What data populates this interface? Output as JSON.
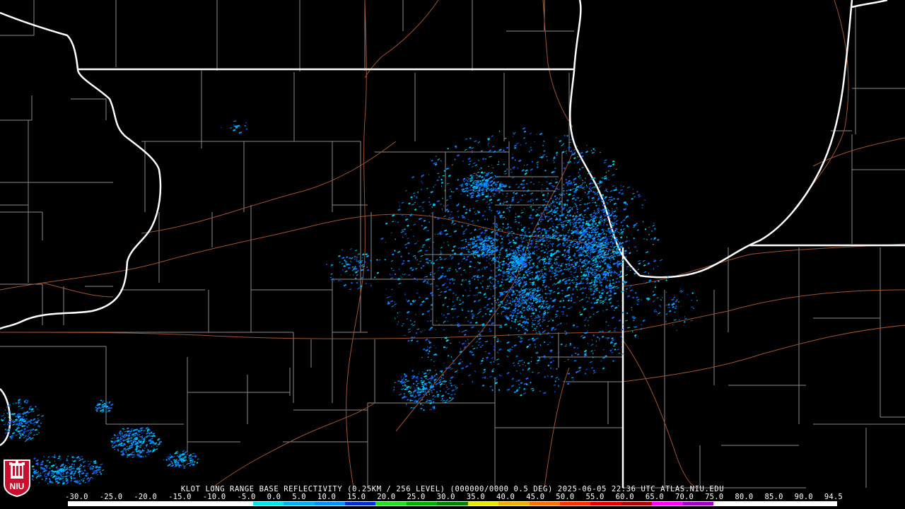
{
  "caption": "KLOT LONG RANGE BASE REFLECTIVITY (0.25KM / 256 LEVEL) (000000/0000 0.5 DEG) 2025-06-05 22:36 UTC  ATLAS.NIU.EDU",
  "scale": {
    "labels": [
      "-30.0",
      "-25.0",
      "-20.0",
      "-15.0",
      "-10.0",
      "-5.0",
      "0.0",
      "5.0",
      "10.0",
      "15.0",
      "20.0",
      "25.0",
      "30.0",
      "35.0",
      "40.0",
      "45.0",
      "50.0",
      "55.0",
      "60.0",
      "65.0",
      "70.0",
      "75.0",
      "80.0",
      "85.0",
      "90.0",
      "94.5"
    ],
    "colors": [
      "#ffffff",
      "#ffffff",
      "#ffffff",
      "#ffffff",
      "#ffffff",
      "#ffffff",
      "#00e5e5",
      "#00b0f0",
      "#0090ff",
      "#0030d0",
      "#20e020",
      "#00b000",
      "#008000",
      "#e8e800",
      "#f0b000",
      "#ff7000",
      "#ff3000",
      "#e00000",
      "#b00000",
      "#ff00ff",
      "#a000c8",
      "#ffffff",
      "#ffffff",
      "#ffffff",
      "#ffffff"
    ]
  },
  "logo": {
    "text": "NIU",
    "color": "#c8102e"
  },
  "map": {
    "background": "#000000",
    "boundary_color": "#ffffff",
    "county_color": "#8a8a8a",
    "road_color": "#a0522d"
  },
  "echo_colors": [
    "#00b8f0",
    "#0090ff",
    "#1e6fff",
    "#00d8e8",
    "#2050e0",
    "#00a0ff",
    "#0060e0"
  ]
}
